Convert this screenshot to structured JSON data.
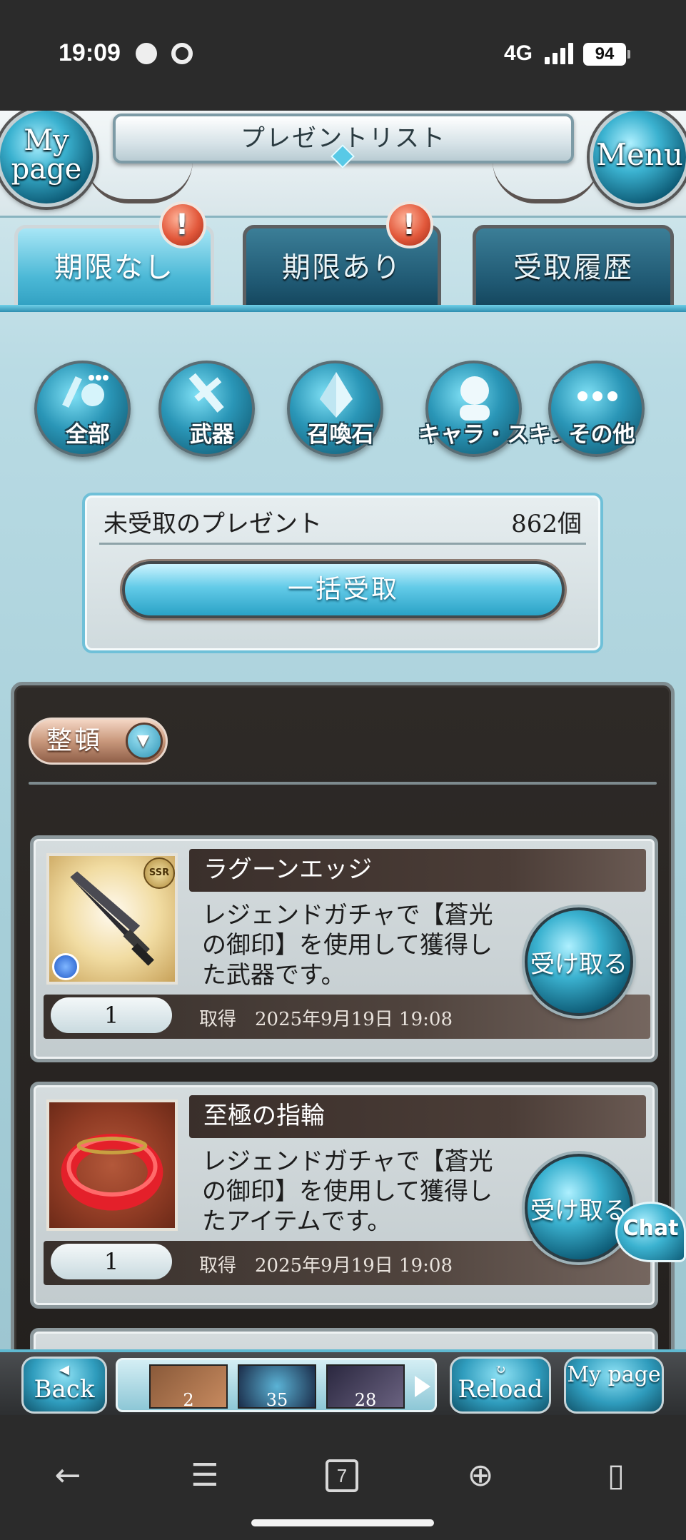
{
  "status_bar": {
    "time": "19:09",
    "network": "4G",
    "battery": "94"
  },
  "header": {
    "title": "プレゼントリスト",
    "mypage_label": "My page",
    "menu_label": "Menu"
  },
  "tabs": [
    {
      "label": "期限なし",
      "active": true,
      "alert": true
    },
    {
      "label": "期限あり",
      "active": false,
      "alert": true
    },
    {
      "label": "受取履歴",
      "active": false,
      "alert": false
    }
  ],
  "alert_glyph": "!",
  "filters": [
    {
      "label": "全部",
      "icon": "all-icon"
    },
    {
      "label": "武器",
      "icon": "sword-icon"
    },
    {
      "label": "召喚石",
      "icon": "crystal-icon"
    },
    {
      "label": "キャラ・スキン",
      "icon": "character-icon"
    },
    {
      "label": "その他",
      "icon": "more-icon"
    }
  ],
  "unclaimed": {
    "label": "未受取のプレゼント",
    "count": "862個",
    "bulk_button": "一括受取"
  },
  "sort": {
    "label": "整頓"
  },
  "items": [
    {
      "name": "ラグーンエッジ",
      "description": "レジェンドガチャで【蒼光の御印】を使用して獲得した武器です。",
      "quantity": "1",
      "acquired": "取得　2025年9月19日 19:08",
      "button": "受け取る",
      "rarity": "SSR",
      "thumb_icon": "dagger-icon"
    },
    {
      "name": "至極の指輪",
      "description": "レジェンドガチャで【蒼光の御印】を使用して獲得したアイテムです。",
      "quantity": "1",
      "acquired": "取得　2025年9月19日 19:08",
      "button": "受け取る",
      "thumb_icon": "red-ring-icon"
    }
  ],
  "chat": {
    "label": "Chat"
  },
  "footer": {
    "back_label": "Back",
    "reload_label": "Reload",
    "mypage_label": "My page",
    "slots": [
      "2",
      "35",
      "28"
    ]
  },
  "android_nav": {
    "tab_count": "7"
  }
}
